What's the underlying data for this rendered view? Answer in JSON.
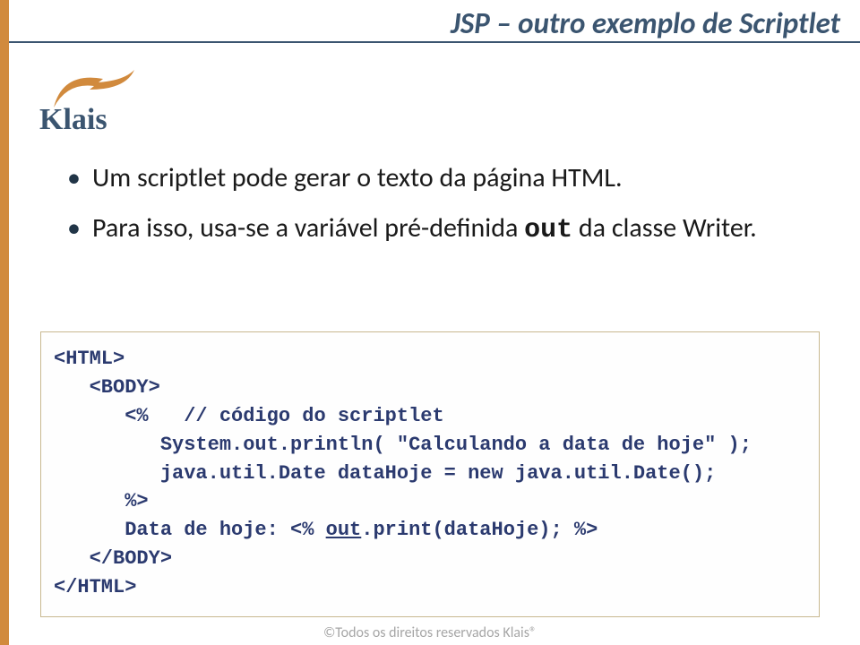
{
  "title": "JSP – outro exemplo de Scriptlet",
  "logo_text": "Klais",
  "bullets": [
    {
      "text_before": "Um scriptlet pode gerar o texto da página HTML."
    },
    {
      "text_before": "Para isso, usa-se a variável pré-definida ",
      "mono": "out",
      "text_after": " da classe Writer."
    }
  ],
  "code": {
    "l1": "<HTML>",
    "l2": "   <BODY>",
    "l3": "      <%   // código do scriptlet",
    "l4": "         System.out.println( \"Calculando a data de hoje\" );",
    "l5": "         java.util.Date dataHoje = new java.util.Date();",
    "l6": "      %>",
    "l7a": "      Data de hoje: <% ",
    "l7u": "out",
    "l7b": ".print(dataHoje); %>",
    "l8": "   </BODY>",
    "l9": "</HTML>"
  },
  "footer": "©Todos os direitos reservados Klais®"
}
